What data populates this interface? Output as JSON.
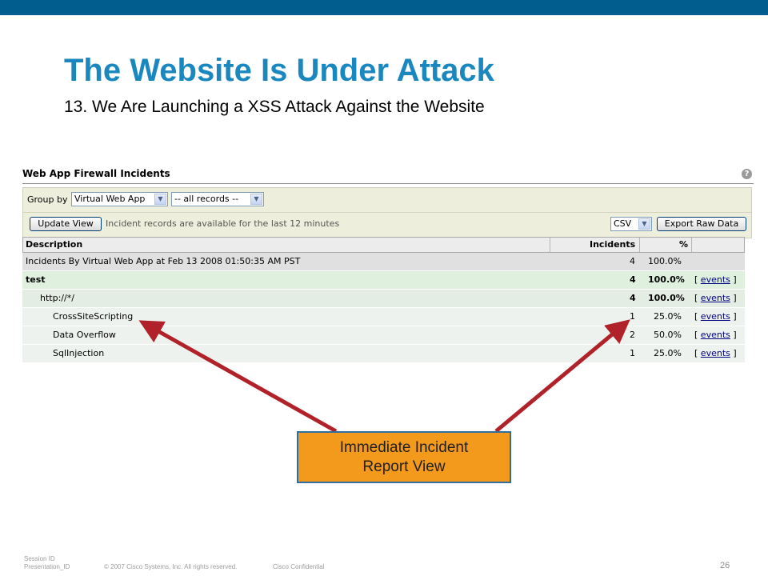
{
  "slide": {
    "title": "The Website Is Under Attack",
    "subtitle": "13. We Are Launching a XSS Attack Against the Website"
  },
  "panel": {
    "title": "Web App Firewall Incidents",
    "help_icon": "?",
    "toolbar": {
      "group_by_label": "Group by",
      "group_by_value": "Virtual Web App",
      "records_value": "-- all records --",
      "update_button": "Update View",
      "note": "Incident records are available for the last 12 minutes",
      "format_value": "CSV",
      "export_button": "Export Raw Data"
    },
    "table": {
      "columns": [
        "Description",
        "Incidents",
        "%"
      ],
      "summary": {
        "description": "Incidents By Virtual Web App at Feb 13 2008 01:50:35 AM PST",
        "incidents": "4",
        "percent": "100.0%"
      },
      "rows": [
        {
          "description": "test",
          "incidents": "4",
          "percent": "100.0%",
          "link_open": "[",
          "link": "events",
          "link_close": "]"
        },
        {
          "description": "http://*/",
          "incidents": "4",
          "percent": "100.0%",
          "link_open": "[",
          "link": "events",
          "link_close": "]"
        },
        {
          "description": "CrossSiteScripting",
          "incidents": "1",
          "percent": "25.0%",
          "link_open": "[",
          "link": "events",
          "link_close": "]"
        },
        {
          "description": "Data Overflow",
          "incidents": "2",
          "percent": "50.0%",
          "link_open": "[",
          "link": "events",
          "link_close": "]"
        },
        {
          "description": "SqlInjection",
          "incidents": "1",
          "percent": "25.0%",
          "link_open": "[",
          "link": "events",
          "link_close": "]"
        }
      ]
    }
  },
  "callout": {
    "line1": "Immediate Incident",
    "line2": "Report View"
  },
  "footer": {
    "session": "Session ID",
    "presentation": "Presentation_ID",
    "copyright": "© 2007 Cisco Systems, Inc. All rights reserved.",
    "confidential": "Cisco Confidential",
    "page": "26"
  },
  "colors": {
    "top_bar": "#005d8d",
    "title": "#1a88bf",
    "callout_fill": "#f39a1d",
    "callout_border": "#2f6e9e",
    "arrow": "#b0212a"
  }
}
